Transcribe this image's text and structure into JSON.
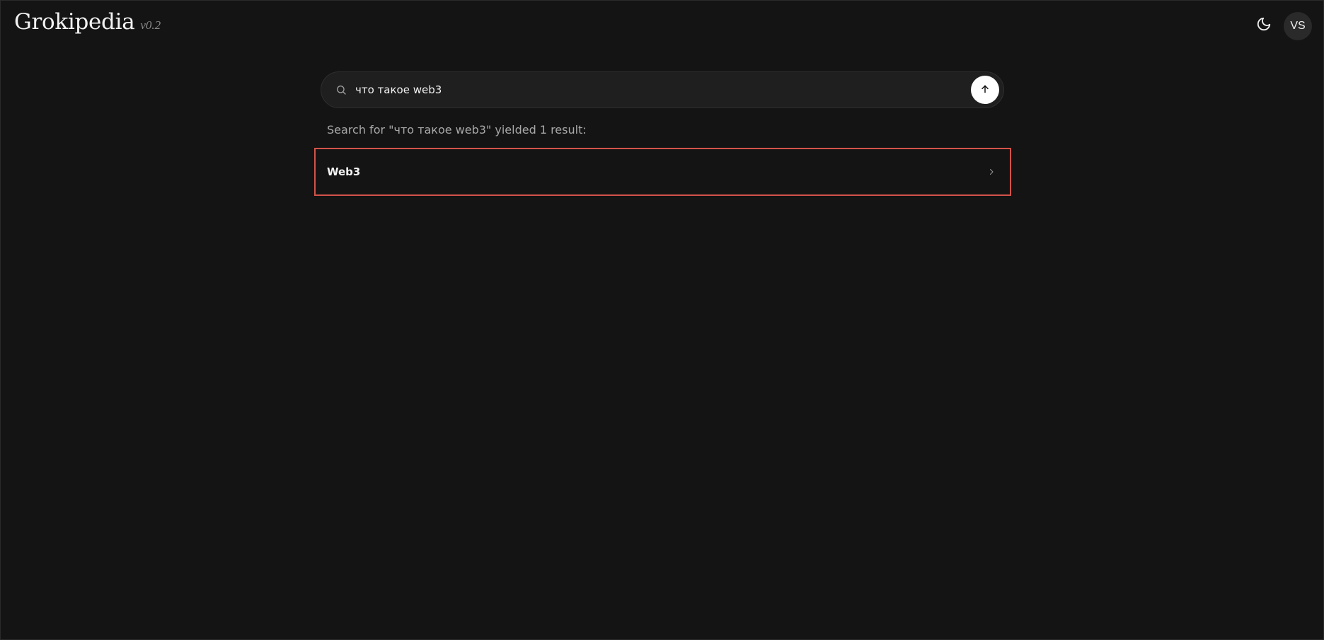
{
  "header": {
    "logo_name": "Grokipedia",
    "logo_version": "v0.2",
    "theme_icon": "moon-icon",
    "avatar_initials": "VS"
  },
  "search": {
    "query": "что такое web3",
    "icon": "search-icon",
    "submit_icon": "arrow-up-icon"
  },
  "results": {
    "summary": "Search for \"что такое web3\" yielded 1 result:",
    "items": [
      {
        "title": "Web3",
        "icon": "chevron-right-icon"
      }
    ]
  },
  "colors": {
    "background": "#141414",
    "highlight_border": "#d2524a",
    "search_bg": "#1f1f1f"
  }
}
